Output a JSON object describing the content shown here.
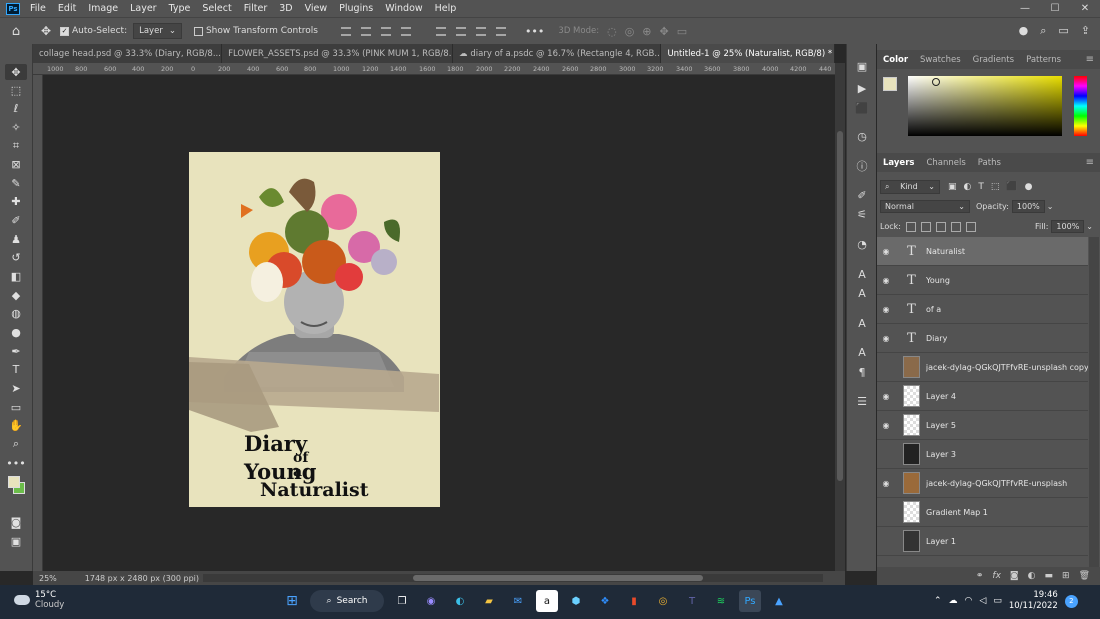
{
  "app": {
    "logo_text": "Ps"
  },
  "menu": [
    "File",
    "Edit",
    "Image",
    "Layer",
    "Type",
    "Select",
    "Filter",
    "3D",
    "View",
    "Plugins",
    "Window",
    "Help"
  ],
  "window_controls": [
    "—",
    "☐",
    "✕"
  ],
  "options_bar": {
    "auto_select_label": "Auto-Select:",
    "auto_select_value": "Layer",
    "show_transform_label": "Show Transform Controls",
    "mode_3d_label": "3D Mode:"
  },
  "tabs": [
    {
      "label": "collage head.psd @ 33.3% (Diary, RGB/8...",
      "close": "×"
    },
    {
      "label": "FLOWER_ASSETS.psd @ 33.3% (PINK MUM 1, RGB/8...",
      "close": "×"
    },
    {
      "label": "☁ diary of a.psdc @ 16.7% (Rectangle 4, RGB...",
      "close": "×"
    },
    {
      "label": "Untitled-1 @ 25% (Naturalist, RGB/8) *",
      "close": "×"
    }
  ],
  "ruler_ticks": [
    "1000",
    "800",
    "600",
    "400",
    "200",
    "0",
    "200",
    "400",
    "600",
    "800",
    "1000",
    "1200",
    "1400",
    "1600",
    "1800",
    "2000",
    "2200",
    "2400",
    "2600",
    "2800",
    "3000",
    "3200",
    "3400",
    "3600",
    "3800",
    "4000",
    "4200",
    "440"
  ],
  "document": {
    "title_lines": [
      "Diary",
      "of a",
      "Young",
      "Naturalist"
    ],
    "colors": {
      "background": "#e8e3bd",
      "text": "#111111",
      "tape": "#b8a98e"
    }
  },
  "status": {
    "zoom": "25%",
    "dimensions": "1748 px x 2480 px (300 ppi)"
  },
  "color_panel": {
    "tabs": [
      "Color",
      "Swatches",
      "Gradients",
      "Patterns"
    ],
    "foreground": "#e8e3bd",
    "background": "#6bbd4a"
  },
  "layers_panel": {
    "tabs": [
      "Layers",
      "Channels",
      "Paths"
    ],
    "filter_kind": "Kind",
    "blend_mode": "Normal",
    "opacity_label": "Opacity:",
    "opacity_value": "100%",
    "lock_label": "Lock:",
    "fill_label": "Fill:",
    "fill_value": "100%",
    "layers": [
      {
        "name": "Naturalist",
        "type": "text",
        "visible": true,
        "selected": true
      },
      {
        "name": "Young",
        "type": "text",
        "visible": true,
        "selected": false
      },
      {
        "name": "of a",
        "type": "text",
        "visible": true,
        "selected": false
      },
      {
        "name": "Diary",
        "type": "text",
        "visible": true,
        "selected": false
      },
      {
        "name": "jacek-dylag-QGkQJTFfvRE-unsplash copy",
        "type": "pixel",
        "visible": false,
        "selected": false
      },
      {
        "name": "Layer 4",
        "type": "pixel",
        "visible": true,
        "selected": false
      },
      {
        "name": "Layer 5",
        "type": "pixel",
        "visible": true,
        "selected": false
      },
      {
        "name": "Layer 3",
        "type": "pixel",
        "visible": false,
        "selected": false
      },
      {
        "name": "jacek-dylag-QGkQJTFfvRE-unsplash",
        "type": "pixel",
        "visible": true,
        "selected": false
      },
      {
        "name": "Gradient Map 1",
        "type": "pixel",
        "visible": false,
        "selected": false
      },
      {
        "name": "Layer 1",
        "type": "pixel",
        "visible": false,
        "selected": false
      }
    ]
  },
  "taskbar": {
    "weather_temp": "15°C",
    "weather_desc": "Cloudy",
    "search_label": "Search",
    "time": "19:46",
    "date": "10/11/2022",
    "notification_count": "2"
  }
}
